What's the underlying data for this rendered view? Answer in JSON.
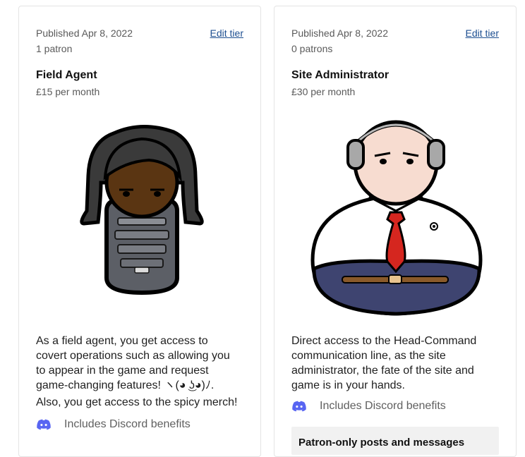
{
  "tiers": [
    {
      "published": "Published Apr 8, 2022",
      "edit_label": "Edit tier",
      "patrons": "1 patron",
      "name": "Field Agent",
      "price": "£15 per month",
      "illustration_icon": "field-agent-avatar",
      "description_lines": [
        "As a field agent, you get access to",
        "covert operations such as allowing you",
        "to appear in the game and request",
        "game-changing features! ヽ(◕ ͜ʖ◕)ﾉ.",
        "Also, you get access to the spicy merch!"
      ],
      "discord_label": "Includes Discord benefits"
    },
    {
      "published": "Published Apr 8, 2022",
      "edit_label": "Edit tier",
      "patrons": "0 patrons",
      "name": "Site Administrator",
      "price": "£30 per month",
      "illustration_icon": "site-admin-avatar",
      "description_lines": [
        "Direct access to the Head-Command",
        "communication line, as the site",
        "administrator, the fate of the site and",
        "game is in your hands."
      ],
      "discord_label": "Includes Discord benefits",
      "benefit_box_heading": "Patron-only posts and messages"
    }
  ],
  "colors": {
    "link": "#1d4f91",
    "discord": "#5865f2",
    "border": "#e4e4e4"
  }
}
